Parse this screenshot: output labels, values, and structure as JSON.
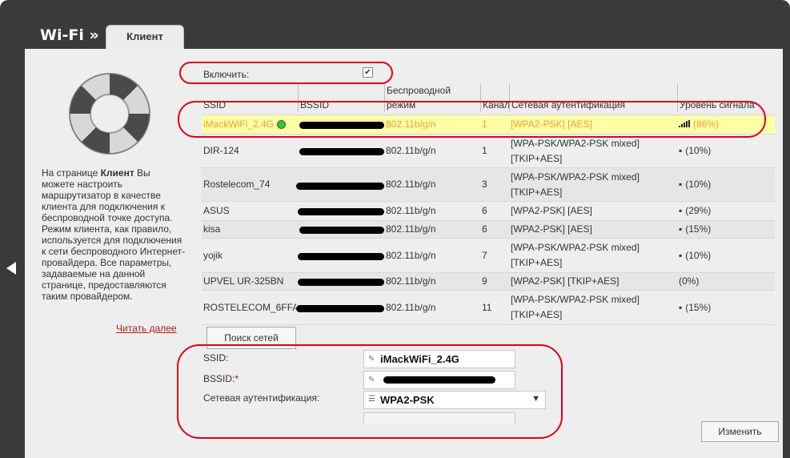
{
  "header": {
    "title": "Wi-Fi »",
    "tab": "Клиент"
  },
  "info": {
    "prefix": "На странице ",
    "bold": "Клиент",
    "text": " Вы можете настроить маршрутизатор в качестве клиента для подключения к беспроводной точке доступа. Режим клиента, как правило, используется для подключения к сети беспроводного Интернет-провайдера. Все параметры, задаваемые на данной странице, предоставляются таким провайдером.",
    "read_more": "Читать далее"
  },
  "enable": {
    "label": "Включить:",
    "checked": "✔"
  },
  "table": {
    "headers": [
      "SSID",
      "BSSID",
      "Беспроводной режим",
      "Канал",
      "Сетевая аутентификация",
      "Уровень сигнала"
    ],
    "rows": [
      {
        "ssid": "iMackWiFi_2.4G",
        "mode": "802.11b/g/n",
        "channel": "1",
        "auth": "[WPA2-PSK] [AES]",
        "signal": "(86%)"
      },
      {
        "ssid": "DIR-124",
        "mode": "802.11b/g/n",
        "channel": "1",
        "auth": "[WPA-PSK/WPA2-PSK mixed] [TKIP+AES]",
        "signal": "(10%)"
      },
      {
        "ssid": "Rostelecom_74",
        "mode": "802.11b/g/n",
        "channel": "3",
        "auth": "[WPA-PSK/WPA2-PSK mixed] [TKIP+AES]",
        "signal": "(10%)"
      },
      {
        "ssid": "ASUS",
        "mode": "802.11b/g/n",
        "channel": "6",
        "auth": "[WPA2-PSK] [AES]",
        "signal": "(29%)"
      },
      {
        "ssid": "kisa",
        "mode": "802.11b/g/n",
        "channel": "6",
        "auth": "[WPA2-PSK] [AES]",
        "signal": "(15%)"
      },
      {
        "ssid": "yojik",
        "mode": "802.11b/g/n",
        "channel": "7",
        "auth": "[WPA-PSK/WPA2-PSK mixed] [TKIP+AES]",
        "signal": "(10%)"
      },
      {
        "ssid": "UPVEL UR-325BN",
        "mode": "802.11b/g/n",
        "channel": "9",
        "auth": "[WPA2-PSK] [TKIP+AES]",
        "signal": "(0%)"
      },
      {
        "ssid": "ROSTELECOM_6FFA",
        "mode": "802.11b/g/n",
        "channel": "11",
        "auth": "[WPA-PSK/WPA2-PSK mixed] [TKIP+AES]",
        "signal": "(15%)"
      }
    ]
  },
  "search_button": "Поиск сетей",
  "form": {
    "ssid_label": "SSID:",
    "ssid_value": "iMackWiFi_2.4G",
    "bssid_label": "BSSID:",
    "bssid_required": "*",
    "auth_label": "Сетевая аутентификация",
    "auth_colon": ":",
    "auth_value": "WPA2-PSK"
  },
  "change_button": "Изменить",
  "colors": {
    "selected_text": "#f0a030",
    "selected_bg": "#ffffa8",
    "annotation": "#e0001a"
  }
}
